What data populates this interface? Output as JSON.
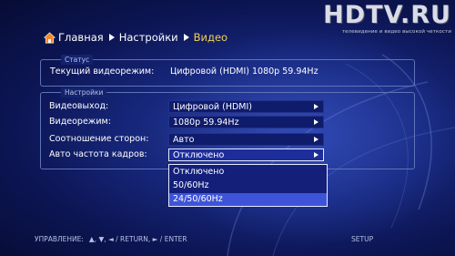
{
  "watermark": {
    "logo": "HDTV.RU",
    "tagline": "телевидение и видео высокой четкости"
  },
  "breadcrumb": {
    "items": [
      "Главная",
      "Настройки",
      "Видео"
    ]
  },
  "status": {
    "legend": "Статус",
    "label": "Текущий видеорежим:",
    "value": "Цифровой (HDMI) 1080p 59.94Hz"
  },
  "settings": {
    "legend": "Настройки",
    "rows": [
      {
        "label": "Видеовыход:",
        "value": "Цифровой (HDMI)"
      },
      {
        "label": "Видеорежим:",
        "value": "1080p 59.94Hz"
      },
      {
        "label": "Соотношение сторон:",
        "value": "Авто"
      },
      {
        "label": "Авто частота кадров:",
        "value": "Отключено"
      }
    ]
  },
  "dropdown": {
    "options": [
      "Отключено",
      "50/60Hz",
      "24/50/60Hz"
    ],
    "highlighted_index": 2
  },
  "footer": {
    "hint_prefix": "УПРАВЛЕНИЕ:",
    "hint_rest": "▲, ▼, ◄ / RETURN, ► / ENTER",
    "setup": "SETUP"
  },
  "colors": {
    "accent_breadcrumb": "#f2d25a",
    "highlight": "#3e54d8",
    "background": "#16267a"
  }
}
